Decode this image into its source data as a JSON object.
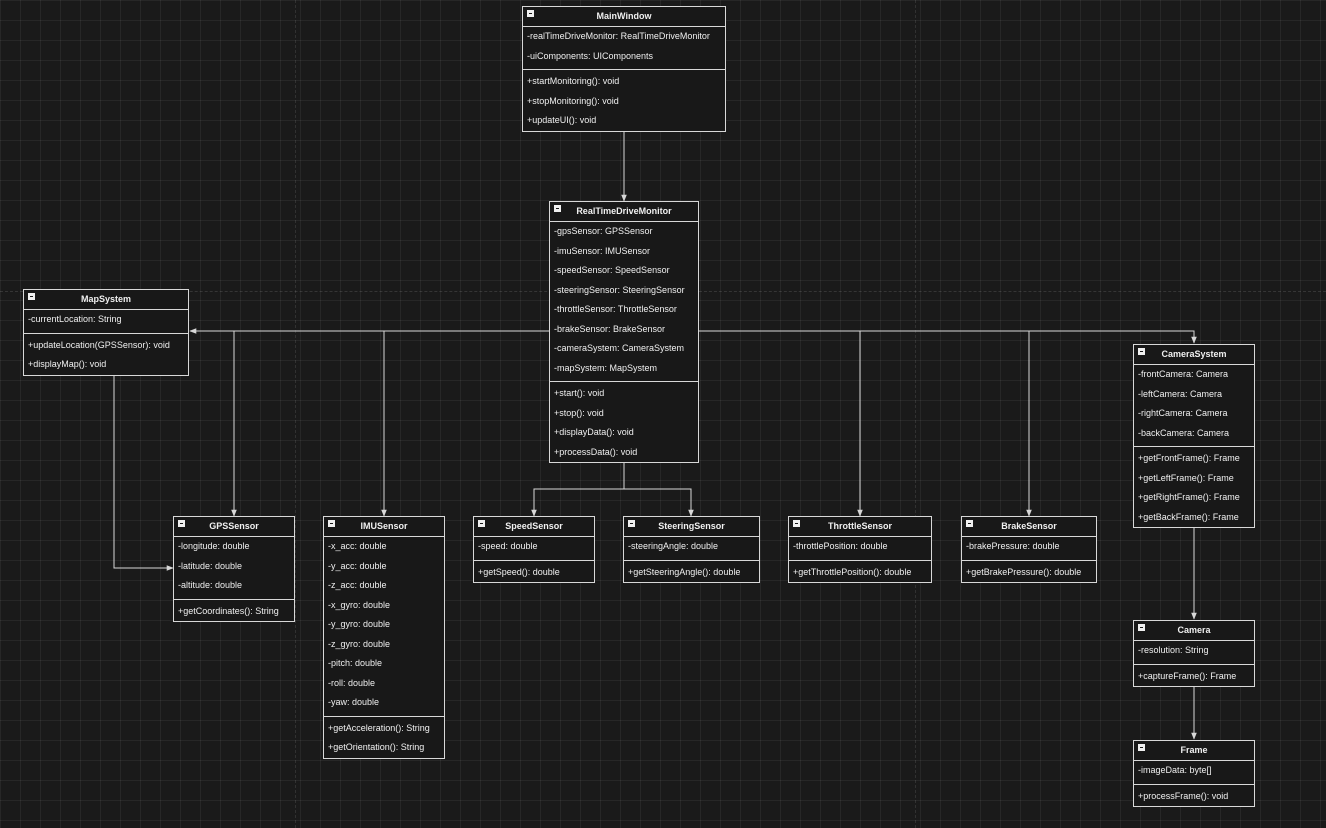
{
  "classes": {
    "main_window": {
      "name": "MainWindow",
      "attributes": [
        "-realTimeDriveMonitor: RealTimeDriveMonitor",
        "-uiComponents: UIComponents"
      ],
      "operations": [
        "+startMonitoring(): void",
        "+stopMonitoring(): void",
        "+updateUI(): void"
      ]
    },
    "real_time_drive_monitor": {
      "name": "RealTimeDriveMonitor",
      "attributes": [
        "-gpsSensor: GPSSensor",
        "-imuSensor: IMUSensor",
        "-speedSensor: SpeedSensor",
        "-steeringSensor: SteeringSensor",
        "-throttleSensor: ThrottleSensor",
        "-brakeSensor: BrakeSensor",
        "-cameraSystem: CameraSystem",
        "-mapSystem: MapSystem"
      ],
      "operations": [
        "+start(): void",
        "+stop(): void",
        "+displayData(): void",
        "+processData(): void"
      ]
    },
    "map_system": {
      "name": "MapSystem",
      "attributes": [
        "-currentLocation: String"
      ],
      "operations": [
        "+updateLocation(GPSSensor): void",
        "+displayMap(): void"
      ]
    },
    "camera_system": {
      "name": "CameraSystem",
      "attributes": [
        "-frontCamera: Camera",
        "-leftCamera: Camera",
        "-rightCamera: Camera",
        "-backCamera: Camera"
      ],
      "operations": [
        "+getFrontFrame(): Frame",
        "+getLeftFrame(): Frame",
        "+getRightFrame(): Frame",
        "+getBackFrame(): Frame"
      ]
    },
    "gps_sensor": {
      "name": "GPSSensor",
      "attributes": [
        "-longitude: double",
        "-latitude: double",
        "-altitude: double"
      ],
      "operations": [
        "+getCoordinates(): String"
      ]
    },
    "imu_sensor": {
      "name": "IMUSensor",
      "attributes": [
        "-x_acc: double",
        "-y_acc: double",
        "-z_acc: double",
        "-x_gyro: double",
        "-y_gyro: double",
        "-z_gyro: double",
        "-pitch: double",
        "-roll: double",
        "-yaw: double"
      ],
      "operations": [
        "+getAcceleration(): String",
        "+getOrientation(): String"
      ]
    },
    "speed_sensor": {
      "name": "SpeedSensor",
      "attributes": [
        "-speed: double"
      ],
      "operations": [
        "+getSpeed(): double"
      ]
    },
    "steering_sensor": {
      "name": "SteeringSensor",
      "attributes": [
        "-steeringAngle: double"
      ],
      "operations": [
        "+getSteeringAngle(): double"
      ]
    },
    "throttle_sensor": {
      "name": "ThrottleSensor",
      "attributes": [
        "-throttlePosition: double"
      ],
      "operations": [
        "+getThrottlePosition(): double"
      ]
    },
    "brake_sensor": {
      "name": "BrakeSensor",
      "attributes": [
        "-brakePressure: double"
      ],
      "operations": [
        "+getBrakePressure(): double"
      ]
    },
    "camera": {
      "name": "Camera",
      "attributes": [
        "-resolution: String"
      ],
      "operations": [
        "+captureFrame(): Frame"
      ]
    },
    "frame": {
      "name": "Frame",
      "attributes": [
        "-imageData: byte[]"
      ],
      "operations": [
        "+processFrame(): void"
      ]
    }
  },
  "relations": [
    {
      "from": "MainWindow",
      "to": "RealTimeDriveMonitor"
    },
    {
      "from": "RealTimeDriveMonitor",
      "to": "MapSystem"
    },
    {
      "from": "RealTimeDriveMonitor",
      "to": "GPSSensor"
    },
    {
      "from": "RealTimeDriveMonitor",
      "to": "IMUSensor"
    },
    {
      "from": "RealTimeDriveMonitor",
      "to": "SpeedSensor"
    },
    {
      "from": "RealTimeDriveMonitor",
      "to": "SteeringSensor"
    },
    {
      "from": "RealTimeDriveMonitor",
      "to": "ThrottleSensor"
    },
    {
      "from": "RealTimeDriveMonitor",
      "to": "BrakeSensor"
    },
    {
      "from": "RealTimeDriveMonitor",
      "to": "CameraSystem"
    },
    {
      "from": "MapSystem",
      "to": "GPSSensor"
    },
    {
      "from": "CameraSystem",
      "to": "Camera"
    },
    {
      "from": "Camera",
      "to": "Frame"
    }
  ],
  "colors": {
    "background": "#1a1a1a",
    "line": "#d8d8d8",
    "text": "#f0f0f0"
  }
}
